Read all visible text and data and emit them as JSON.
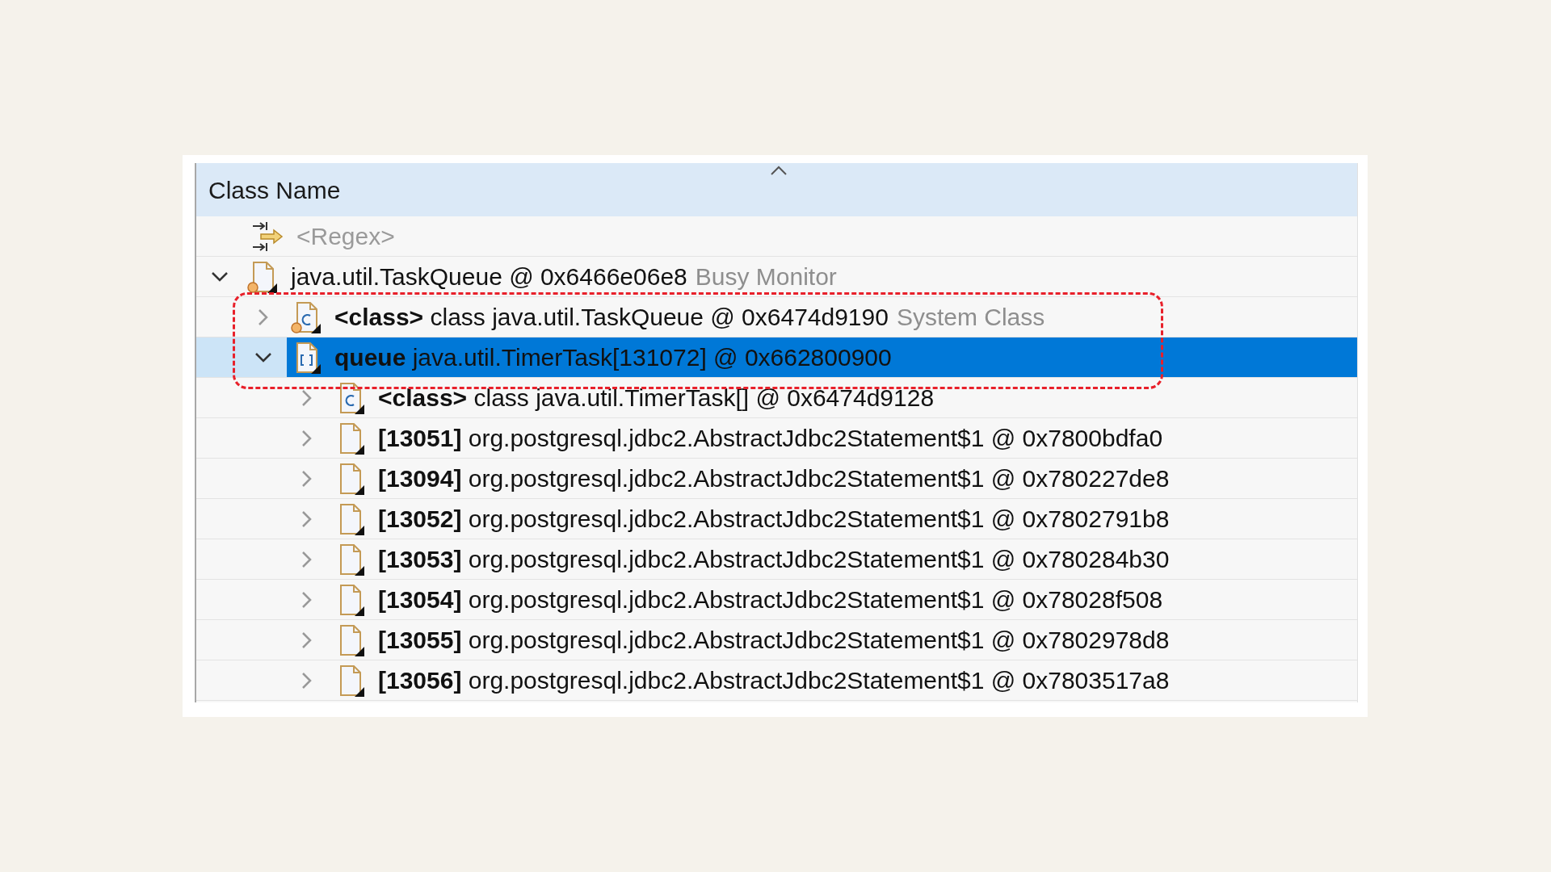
{
  "column_header": {
    "label": "Class Name",
    "sorted": true
  },
  "filter": {
    "placeholder": "<Regex>"
  },
  "tree": [
    {
      "kind": "object_root",
      "label": "java.util.TaskQueue @ 0x6466e06e8",
      "note": "Busy Monitor",
      "expanded": true,
      "selected": false,
      "children": [
        {
          "kind": "class_root",
          "label": "**<class>** class java.util.TaskQueue @ 0x6474d9190",
          "note": "System Class",
          "expanded": false,
          "selected": false
        },
        {
          "kind": "array",
          "label": "**queue** java.util.TimerTask[131072] @ 0x662800900",
          "expanded": true,
          "selected": true,
          "children": [
            {
              "kind": "class",
              "label": "**<class>** class java.util.TimerTask[] @ 0x6474d9128",
              "expanded": false,
              "selected": false
            },
            {
              "kind": "object",
              "label": "**[13051]** org.postgresql.jdbc2.AbstractJdbc2Statement$1 @ 0x7800bdfa0",
              "expanded": false,
              "selected": false
            },
            {
              "kind": "object",
              "label": "**[13094]** org.postgresql.jdbc2.AbstractJdbc2Statement$1 @ 0x780227de8",
              "expanded": false,
              "selected": false
            },
            {
              "kind": "object",
              "label": "**[13052]** org.postgresql.jdbc2.AbstractJdbc2Statement$1 @ 0x7802791b8",
              "expanded": false,
              "selected": false
            },
            {
              "kind": "object",
              "label": "**[13053]** org.postgresql.jdbc2.AbstractJdbc2Statement$1 @ 0x780284b30",
              "expanded": false,
              "selected": false
            },
            {
              "kind": "object",
              "label": "**[13054]** org.postgresql.jdbc2.AbstractJdbc2Statement$1 @ 0x78028f508",
              "expanded": false,
              "selected": false
            },
            {
              "kind": "object",
              "label": "**[13055]** org.postgresql.jdbc2.AbstractJdbc2Statement$1 @ 0x7802978d8",
              "expanded": false,
              "selected": false
            },
            {
              "kind": "object",
              "label": "**[13056]** org.postgresql.jdbc2.AbstractJdbc2Statement$1 @ 0x7803517a8",
              "expanded": false,
              "selected": false
            }
          ]
        }
      ]
    }
  ]
}
